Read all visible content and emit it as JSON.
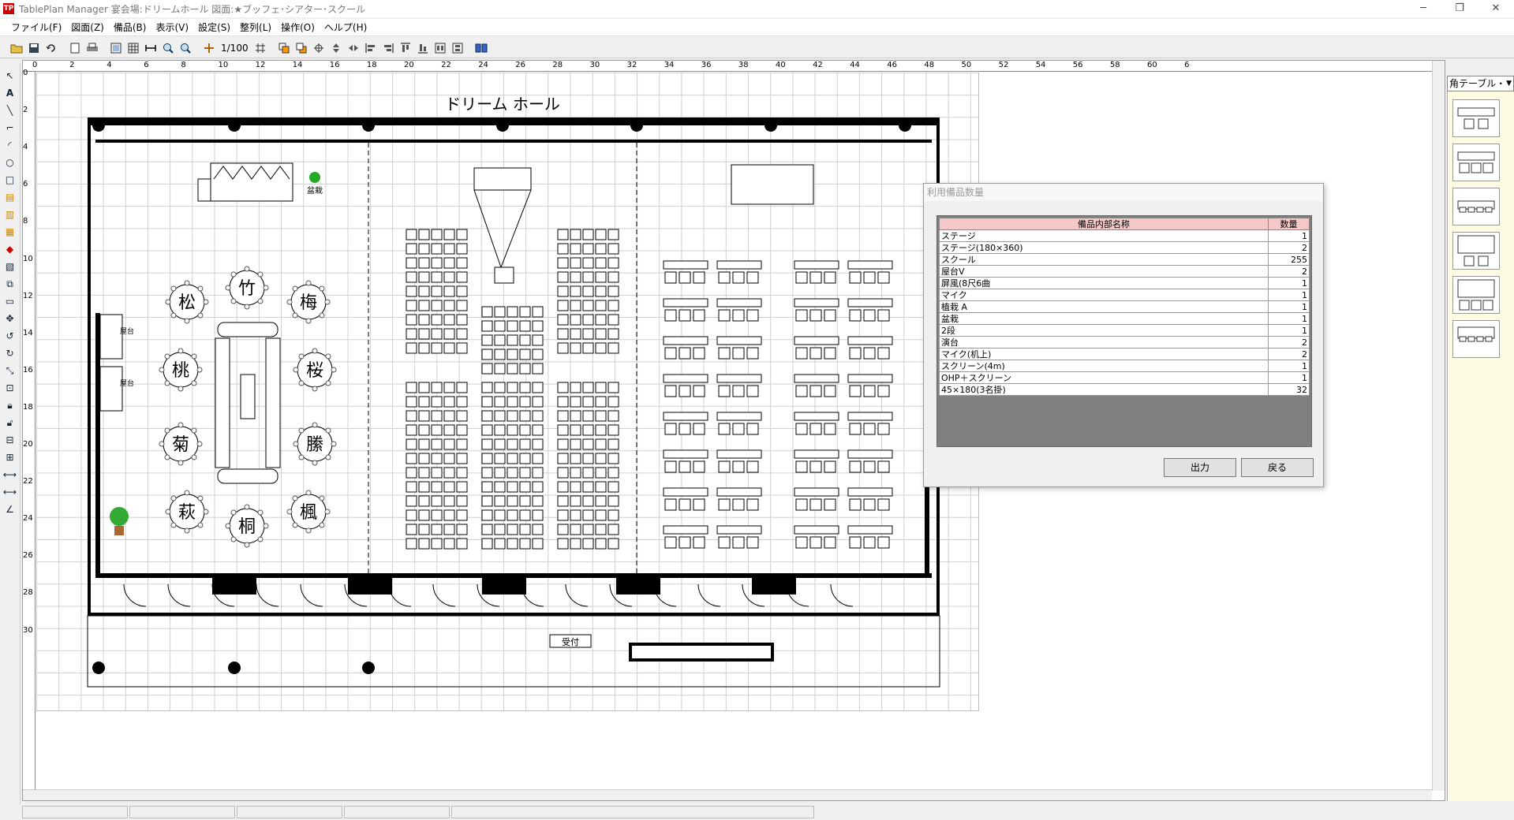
{
  "window": {
    "app_icon_text": "TP",
    "title": "TablePlan Manager  宴会場:ドリームホール  図面:★ブッフェ･シアター･スクール",
    "btn_min": "─",
    "btn_restore": "❐",
    "btn_close": "✕"
  },
  "menu": [
    "ファイル(F)",
    "図面(Z)",
    "備品(B)",
    "表示(V)",
    "設定(S)",
    "整列(L)",
    "操作(O)",
    "ヘルプ(H)"
  ],
  "toolbar": {
    "scale": "1/100"
  },
  "ruler": {
    "h_ticks": [
      "0",
      "2",
      "4",
      "6",
      "8",
      "10",
      "12",
      "14",
      "16",
      "18",
      "20",
      "22",
      "24",
      "26",
      "28",
      "30",
      "32",
      "34",
      "36",
      "38",
      "40",
      "42",
      "44",
      "46",
      "48",
      "50",
      "52",
      "54",
      "56",
      "58",
      "60",
      "6"
    ],
    "v_ticks": [
      "0",
      "2",
      "4",
      "6",
      "8",
      "10",
      "12",
      "14",
      "16",
      "18",
      "20",
      "22",
      "24",
      "26",
      "28",
      "30"
    ]
  },
  "plan": {
    "hall_title": "ドリーム ホール",
    "tables": [
      "松",
      "竹",
      "梅",
      "桃",
      "桜",
      "菊",
      "縢",
      "萩",
      "桐",
      "楓"
    ],
    "reception_label": "受付",
    "podium_label": "盆栽",
    "side_labels": [
      "屋台",
      "屋台"
    ]
  },
  "right_panel": {
    "selected": "角テーブル・"
  },
  "dialog": {
    "title": "利用備品数量",
    "col_name": "備品内部名称",
    "col_qty": "数量",
    "rows": [
      {
        "name": "ステージ",
        "qty": "1"
      },
      {
        "name": "ステージ(180×360)",
        "qty": "2"
      },
      {
        "name": "スクール",
        "qty": "255"
      },
      {
        "name": "屋台V",
        "qty": "2"
      },
      {
        "name": "屏風(8尺6曲",
        "qty": "1"
      },
      {
        "name": "マイク",
        "qty": "1"
      },
      {
        "name": "植栽 A",
        "qty": "1"
      },
      {
        "name": "盆栽",
        "qty": "1"
      },
      {
        "name": "2段",
        "qty": "1"
      },
      {
        "name": "演台",
        "qty": "2"
      },
      {
        "name": "マイク(机上)",
        "qty": "2"
      },
      {
        "name": "スクリーン(4m)",
        "qty": "1"
      },
      {
        "name": "OHP＋スクリーン",
        "qty": "1"
      },
      {
        "name": "45×180(3名掛)",
        "qty": "32"
      }
    ],
    "btn_output": "出力",
    "btn_back": "戻る"
  }
}
